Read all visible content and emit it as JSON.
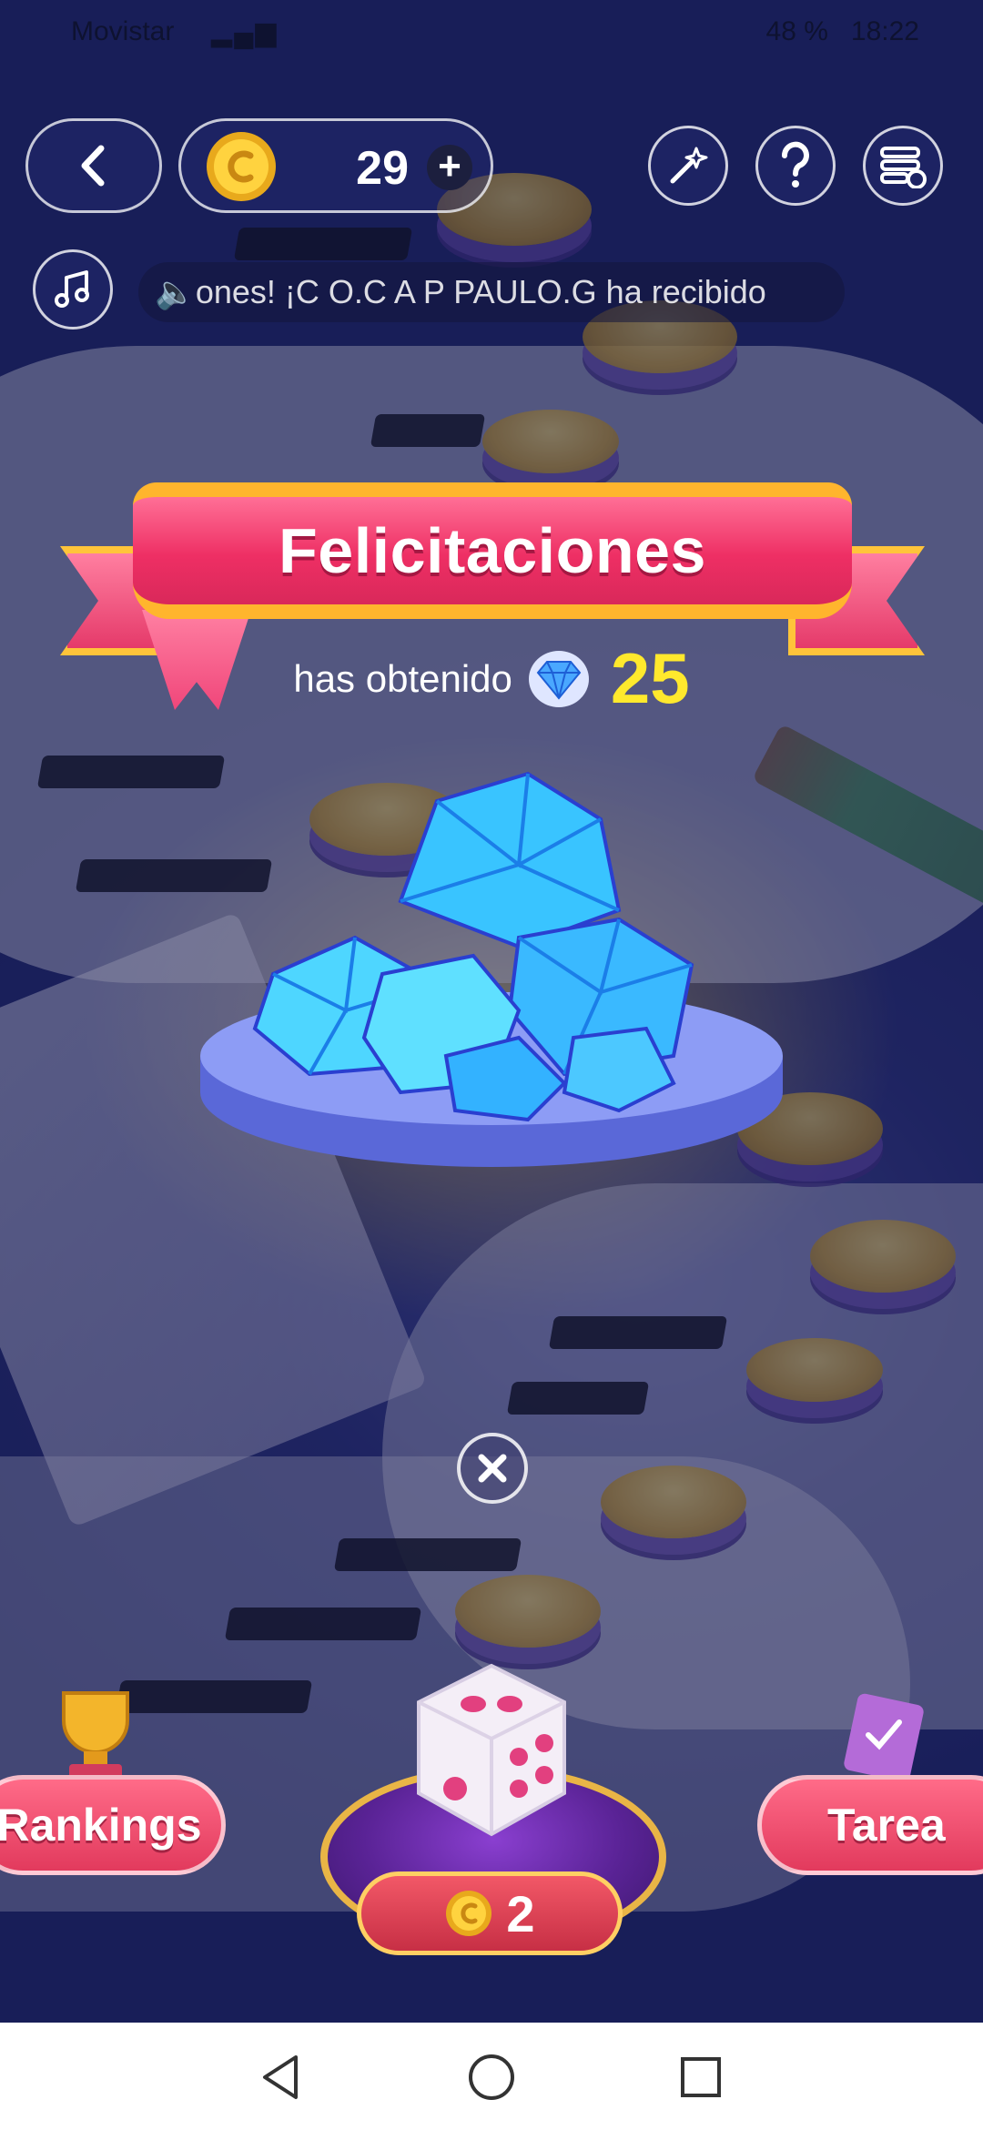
{
  "status_bar": {
    "carrier": "Movistar",
    "battery": "48 %",
    "time": "18:22"
  },
  "top_bar": {
    "coin_count": "29",
    "plus_label": "+"
  },
  "ticker": {
    "text": "ones! ¡C O.C A P PAULO.G ha recibido"
  },
  "reward": {
    "title": "Felicitaciones",
    "subtitle": "has obtenido",
    "amount": "25"
  },
  "bottom": {
    "rankings_label": "Rankings",
    "tarea_label": "Tarea",
    "roll_cost": "2"
  },
  "colors": {
    "ribbon_pink": "#ee2f64",
    "ribbon_gold": "#ffb52d",
    "amount_yellow": "#ffe92d",
    "button_red": "#e23a5d"
  },
  "icons": {
    "back": "chevron-left-icon",
    "coin": "coin-icon",
    "wand": "magic-wand-icon",
    "help": "question-icon",
    "tasks": "task-list-icon",
    "music": "music-note-icon",
    "diamond": "diamond-icon",
    "close": "close-icon",
    "dice": "dice-icon",
    "trophy": "trophy-icon",
    "gift": "gift-icon"
  }
}
